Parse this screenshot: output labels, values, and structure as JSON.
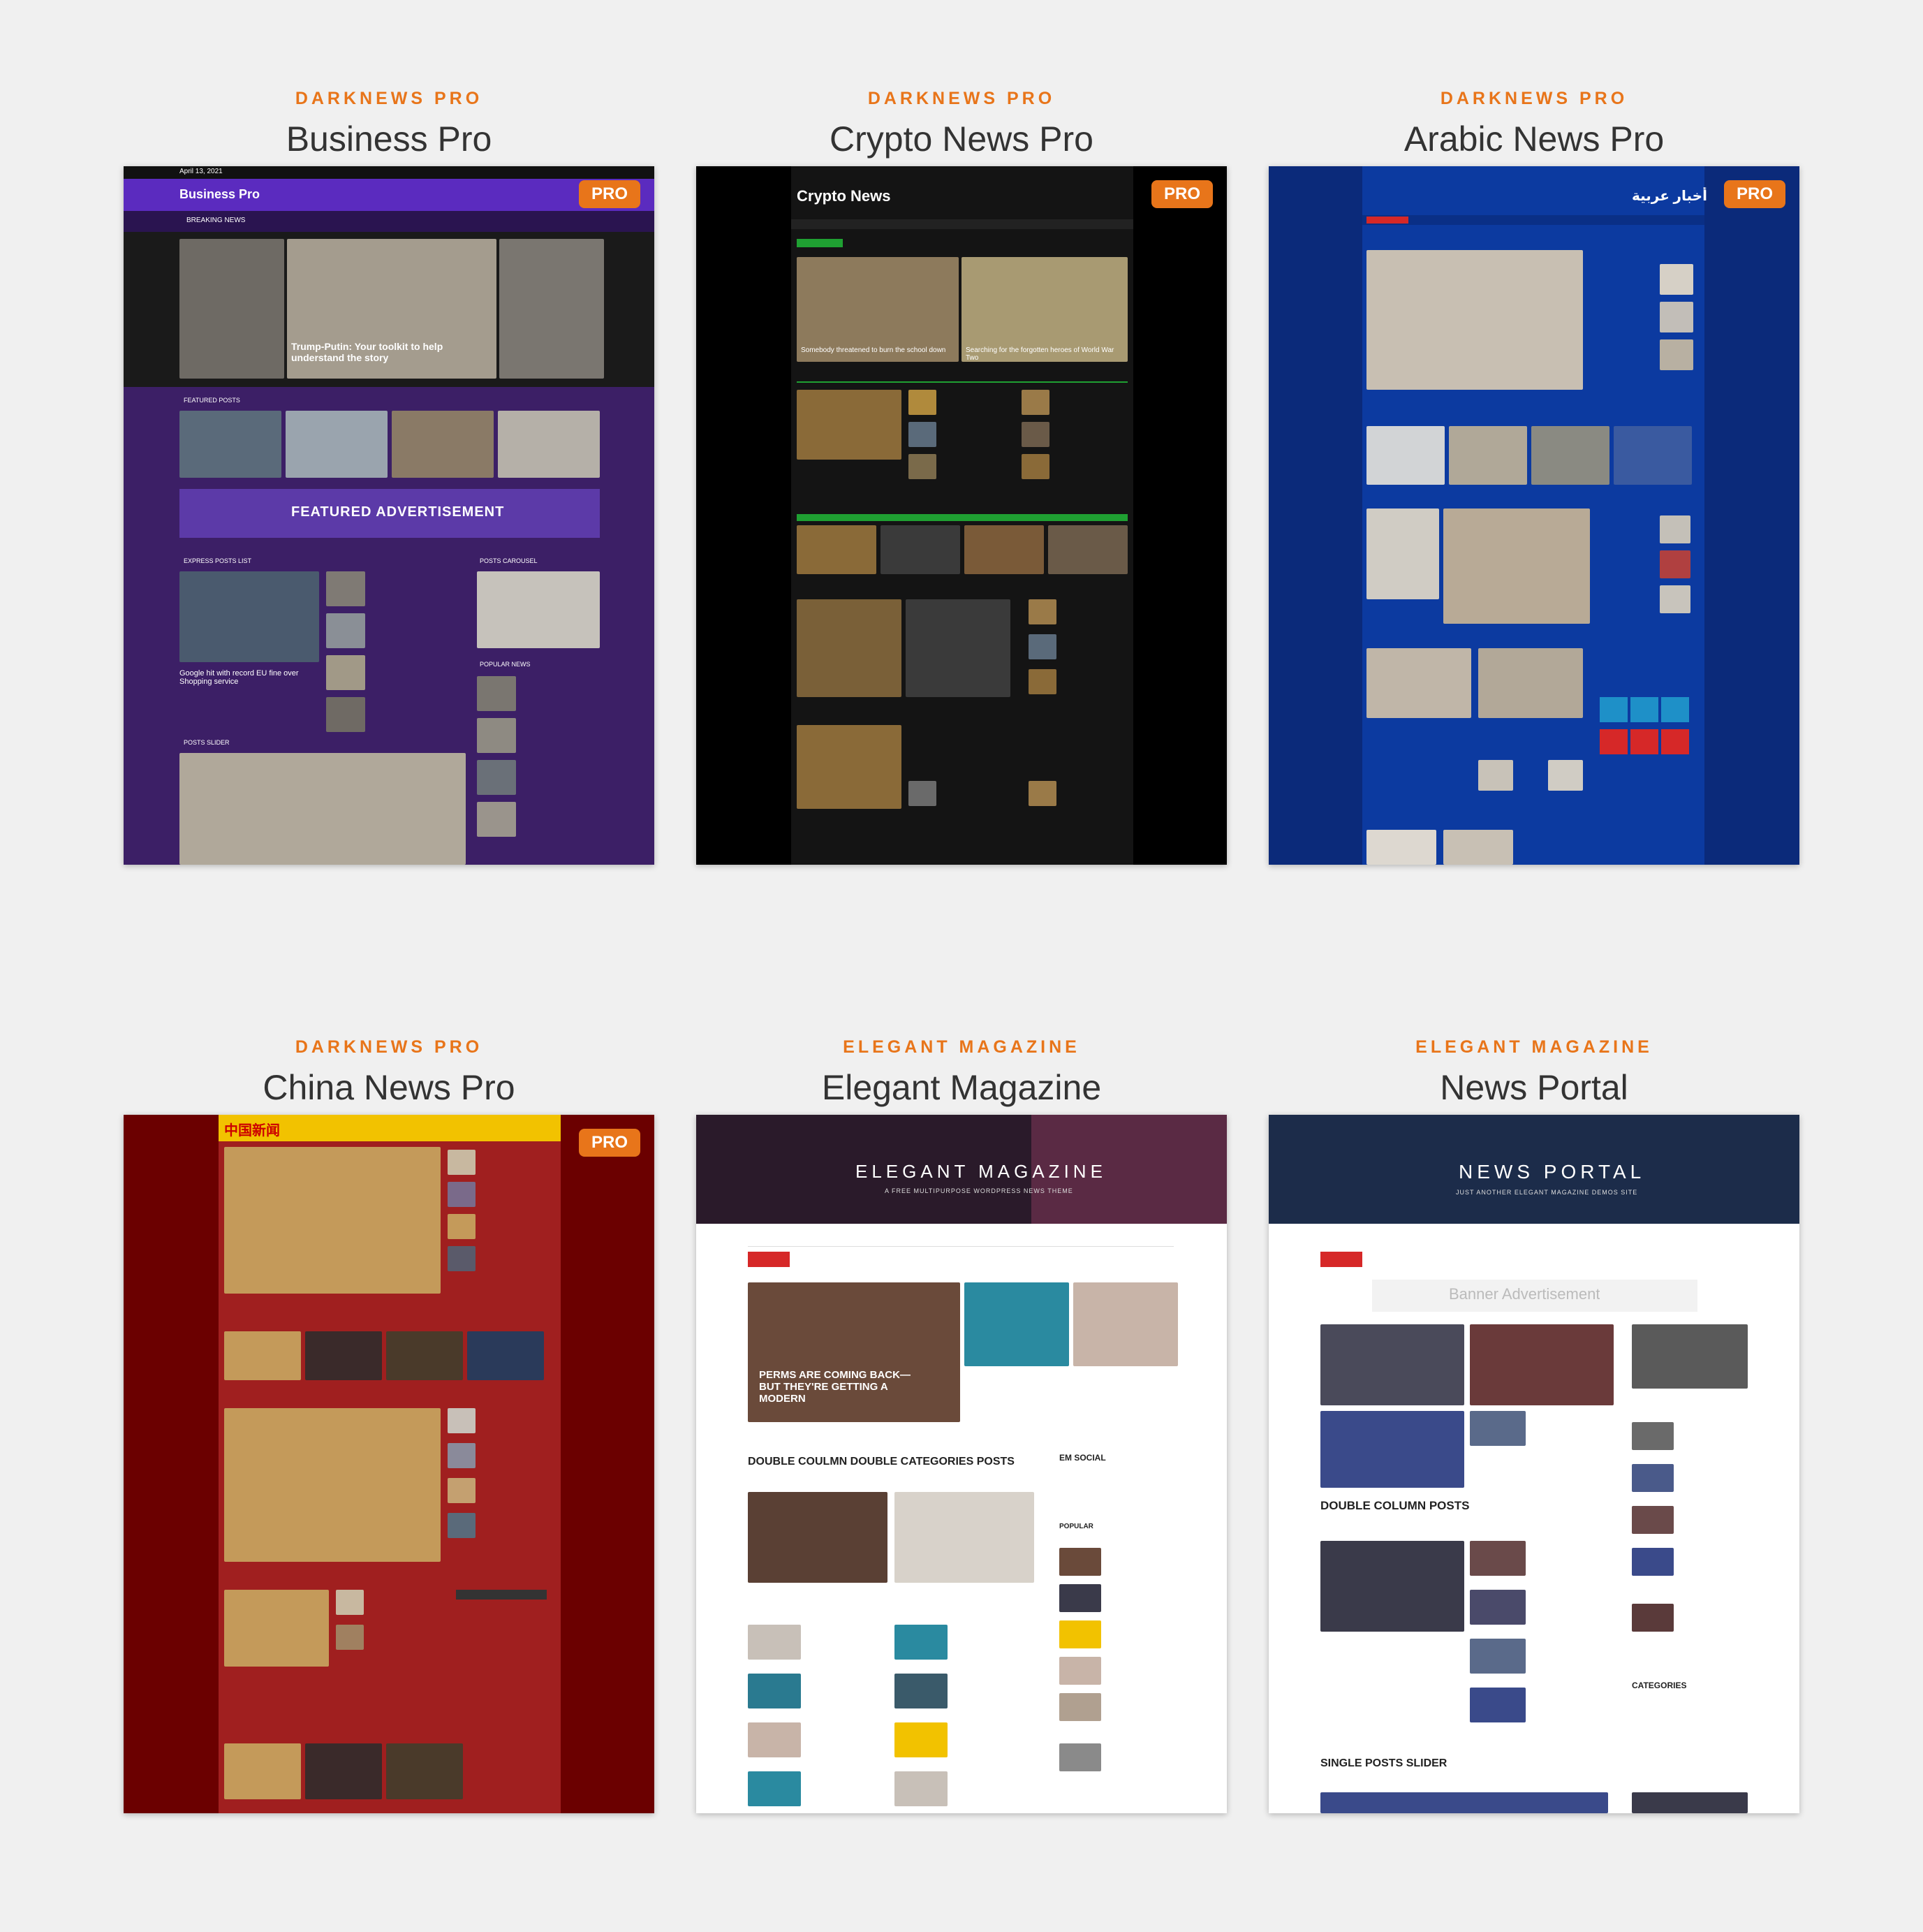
{
  "cards": [
    {
      "brand": "DARKNEWS PRO",
      "title": "Business Pro",
      "pro": "PRO",
      "preview": {
        "date": "April 13, 2021",
        "site_name": "Business Pro",
        "breaking": "BREAKING NEWS",
        "headline": "Trump-Putin: Your toolkit to help understand the story",
        "featured": "FEATURED POSTS",
        "banner": "FEATURED ADVERTISEMENT",
        "express": "EXPRESS POSTS LIST",
        "carousel": "POSTS CAROUSEL",
        "popular": "POPULAR NEWS",
        "slider": "POSTS SLIDER",
        "story": "Google hit with record EU fine over Shopping service"
      }
    },
    {
      "brand": "DARKNEWS PRO",
      "title": "Crypto News Pro",
      "pro": "PRO",
      "preview": {
        "site_name": "Crypto News",
        "headline1": "Somebody threatened to burn the school down",
        "headline2": "Searching for the forgotten heroes of World War Two"
      }
    },
    {
      "brand": "DARKNEWS PRO",
      "title": "Arabic News Pro",
      "pro": "PRO",
      "preview": {
        "site_name": "أخبار عربية"
      }
    },
    {
      "brand": "DARKNEWS PRO",
      "title": "China News Pro",
      "pro": "PRO",
      "preview": {
        "site_name": "中国新闻"
      }
    },
    {
      "brand": "ELEGANT MAGAZINE",
      "title": "Elegant Magazine",
      "preview": {
        "site_name": "ELEGANT MAGAZINE",
        "tagline": "A FREE MULTIPURPOSE WORDPRESS NEWS THEME",
        "headline": "PERMS ARE COMING BACK—BUT THEY'RE GETTING A MODERN",
        "section": "DOUBLE COULMN DOUBLE CATEGORIES POSTS",
        "social": "EM SOCIAL",
        "popular": "POPULAR"
      }
    },
    {
      "brand": "ELEGANT MAGAZINE",
      "title": "News Portal",
      "preview": {
        "site_name": "NEWS PORTAL",
        "tagline": "JUST ANOTHER ELEGANT MAGAZINE DEMOS SITE",
        "banner": "Banner Advertisement",
        "section": "DOUBLE COLUMN POSTS",
        "slider": "SINGLE POSTS SLIDER",
        "categories": "CATEGORIES"
      }
    }
  ],
  "colors": {
    "accent": "#e8751a",
    "business_bg": "#3c1f66",
    "crypto_bg": "#111111",
    "arabic_bg": "#0b2a7a",
    "china_bg": "#6b0000"
  }
}
